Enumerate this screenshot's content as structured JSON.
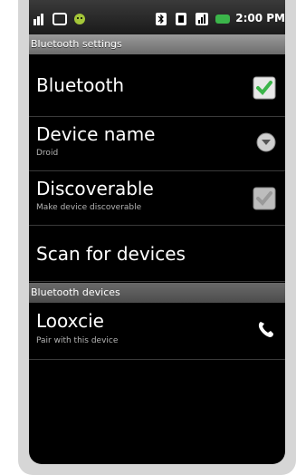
{
  "window": {
    "title": "Bluetooth settings"
  },
  "status_bar": {
    "time": "2:00 PM",
    "icons": [
      "signal-icon",
      "notification-icon",
      "android-icon",
      "bluetooth-icon",
      "vibrate-icon",
      "signal-bars-icon",
      "battery-icon"
    ]
  },
  "settings": [
    {
      "title": "Bluetooth",
      "subtitle": "",
      "control": "checkbox",
      "checked": true
    },
    {
      "title": "Device name",
      "subtitle": "Droid",
      "control": "chevron"
    },
    {
      "title": "Discoverable",
      "subtitle": "Make device discoverable",
      "control": "checkbox",
      "checked": true,
      "disabled": true
    },
    {
      "title": "Scan for devices",
      "subtitle": "",
      "control": "none"
    }
  ],
  "section": {
    "label": "Bluetooth devices"
  },
  "devices": [
    {
      "title": "Looxcie",
      "subtitle": "Pair with this device",
      "control": "phone"
    }
  ],
  "colors": {
    "checkbox_green": "#3bb54a",
    "background": "#000000",
    "text": "#ffffff"
  }
}
